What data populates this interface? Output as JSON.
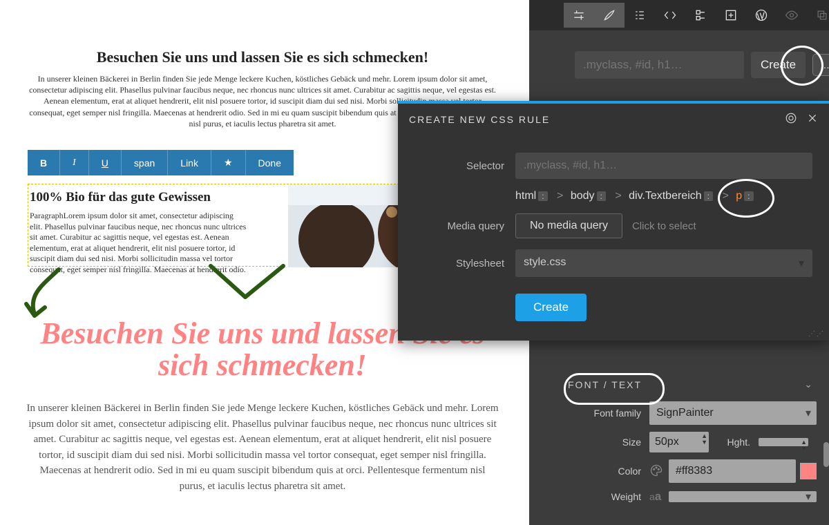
{
  "page": {
    "heading": "Besuchen Sie uns und lassen Sie es sich schmecken!",
    "paragraph": "In unserer kleinen Bäckerei in Berlin finden Sie jede Menge leckere Kuchen, köstliches Gebäck und mehr.  Lorem ipsum dolor sit amet, consectetur adipiscing elit. Phasellus pulvinar faucibus neque, nec rhoncus nunc ultrices sit amet. Curabitur ac sagittis neque, vel egestas est. Aenean elementum, erat at aliquet hendrerit, elit nisl posuere tortor, id suscipit diam dui sed nisi. Morbi sollicitudin massa vel tortor consequat, eget semper nisl fringilla. Maecenas at hendrerit odio. Sed in mi eu quam suscipit bibendum quis at orci. Pellentesque fermentum nisl purus, et iaculis lectus pharetra sit amet.",
    "toolbar": {
      "bold": "B",
      "italic": "I",
      "underline": "U",
      "span": "span",
      "link": "Link",
      "star": "★",
      "done": "Done"
    },
    "box_heading": "100% Bio für das gute Gewissen",
    "box_text": "ParagraphLorem ipsum dolor sit amet, consectetur adipiscing elit. Phasellus pulvinar faucibus neque, nec rhoncus nunc ultrices sit amet. Curabitur ac sagittis neque, vel egestas est. Aenean elementum, erat at aliquet hendrerit, elit nisl posuere tortor, id suscipit diam dui sed nisi. Morbi sollicitudin massa vel tortor consequat, eget semper nisl fringilla. Maecenas at hendrerit odio.",
    "heading_styled": "Besuchen Sie uns und lassen Sie es sich schmecken!",
    "paragraph2": "In unserer kleinen Bäckerei in Berlin finden Sie jede Menge leckere Kuchen, köstliches Gebäck und mehr. Lorem ipsum dolor sit amet, consectetur adipiscing elit. Phasellus pulvinar faucibus neque, nec rhoncus nunc ultrices sit amet. Curabitur ac sagittis neque, vel egestas est. Aenean elementum, erat at aliquet hendrerit, elit nisl posuere tortor, id suscipit diam dui sed nisi. Morbi sollicitudin massa vel tortor consequat, eget semper nisl fringilla. Maecenas at hendrerit odio. Sed in mi eu quam suscipit bibendum quis at orci. Pellentesque fermentum nisl purus, et iaculis lectus pharetra sit amet."
  },
  "sidebar": {
    "selector_placeholder": ".myclass, #id, h1…",
    "create_label": "Create",
    "dots": "…"
  },
  "modal": {
    "title": "CREATE NEW CSS RULE",
    "labels": {
      "selector": "Selector",
      "media": "Media query",
      "stylesheet": "Stylesheet"
    },
    "selector_placeholder": ".myclass, #id, h1…",
    "crumbs": {
      "a": "html",
      "b": "body",
      "c": "div.Textbereich",
      "d": "p",
      "sep": ">",
      ":": ":"
    },
    "media_value": "No media query",
    "media_hint": "Click to select",
    "stylesheet": "style.css",
    "create": "Create"
  },
  "font": {
    "header": "FONT / TEXT",
    "family_label": "Font family",
    "family_value": "SignPainter",
    "size_label": "Size",
    "size_value": "50px",
    "height_label": "Hght.",
    "height_value": "",
    "color_label": "Color",
    "color_value": "#ff8383",
    "weight_label": "Weight",
    "weight_value": ""
  }
}
